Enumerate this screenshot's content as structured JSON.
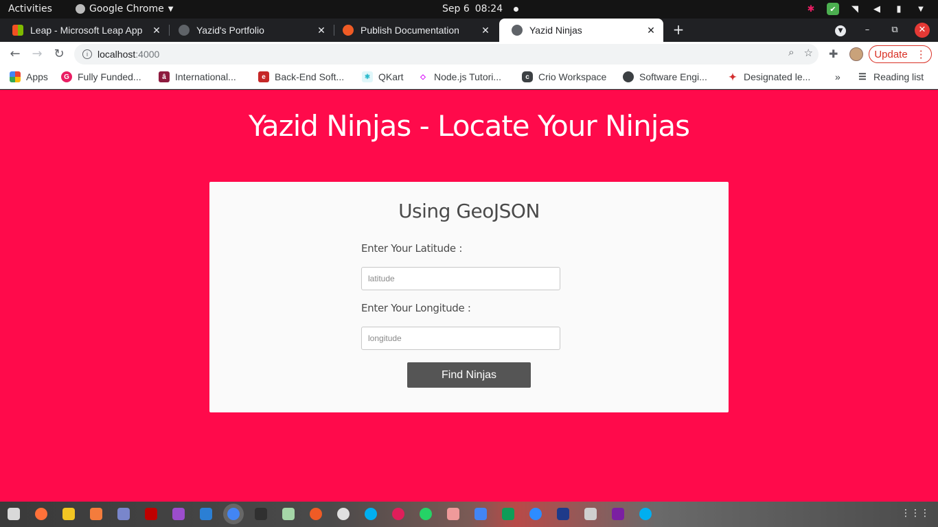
{
  "system_bar": {
    "activities": "Activities",
    "app_name": "Google Chrome",
    "date": "Sep 6",
    "time": "08:24"
  },
  "tabs": [
    {
      "title": "Leap - Microsoft Leap App",
      "active": false
    },
    {
      "title": "Yazid's Portfolio",
      "active": false
    },
    {
      "title": "Publish Documentation",
      "active": false
    },
    {
      "title": "Yazid Ninjas",
      "active": true
    }
  ],
  "address_bar": {
    "host": "localhost",
    "port": ":4000",
    "update_label": "Update"
  },
  "bookmarks": [
    "Apps",
    "Fully Funded...",
    "International...",
    "Back-End Soft...",
    "QKart",
    "Node.js Tutori...",
    "Crio Workspace",
    "Software Engi...",
    "Designated le..."
  ],
  "reading_list": "Reading list",
  "page": {
    "heading": "Yazid Ninjas - Locate Your Ninjas",
    "card_title": "Using GeoJSON",
    "latitude_label": "Enter Your Latitude :",
    "latitude_placeholder": "latitude",
    "longitude_label": "Enter Your Longitude :",
    "longitude_placeholder": "longitude",
    "submit_label": "Find Ninjas"
  },
  "colors": {
    "page_background": "#ff0a4b",
    "card_background": "#fafafa",
    "button_background": "#555555",
    "update_accent": "#d93025"
  },
  "dock_apps": [
    "files-icon",
    "firefox-icon",
    "rhythmbox-icon",
    "software-center-icon",
    "settings-icon",
    "filezilla-icon",
    "video-player-icon",
    "vscode-icon",
    "chrome-icon",
    "terminal-icon",
    "image-viewer-icon",
    "postman-icon",
    "obs-icon",
    "skype-icon",
    "slack-icon",
    "whatsapp-icon",
    "document-scanner-icon",
    "docs-icon",
    "sheets-icon",
    "zoom-icon",
    "photoshop-icon",
    "book-reader-icon",
    "video-editor-icon",
    "skype-alt-icon"
  ]
}
